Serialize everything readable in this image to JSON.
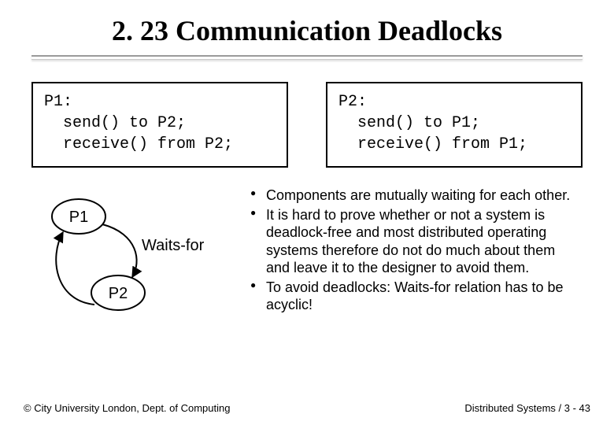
{
  "title": "2. 23 Communication Deadlocks",
  "code_left": "P1:\n  send() to P2;\n  receive() from P2;",
  "code_right": "P2:\n  send() to P1;\n  receive() from P1;",
  "diagram": {
    "node_top": "P1",
    "node_bottom": "P2",
    "edge_label": "Waits-for"
  },
  "bullets": [
    "Components are mutually waiting for each other.",
    "It is hard to prove whether or not a system is deadlock-free and most distributed operating systems therefore do not do much about them and leave it to the designer to avoid them.",
    "To avoid deadlocks: Waits-for relation has to be acyclic!"
  ],
  "footer_left": "© City University London, Dept. of Computing",
  "footer_right": "Distributed Systems / 3 - 43"
}
